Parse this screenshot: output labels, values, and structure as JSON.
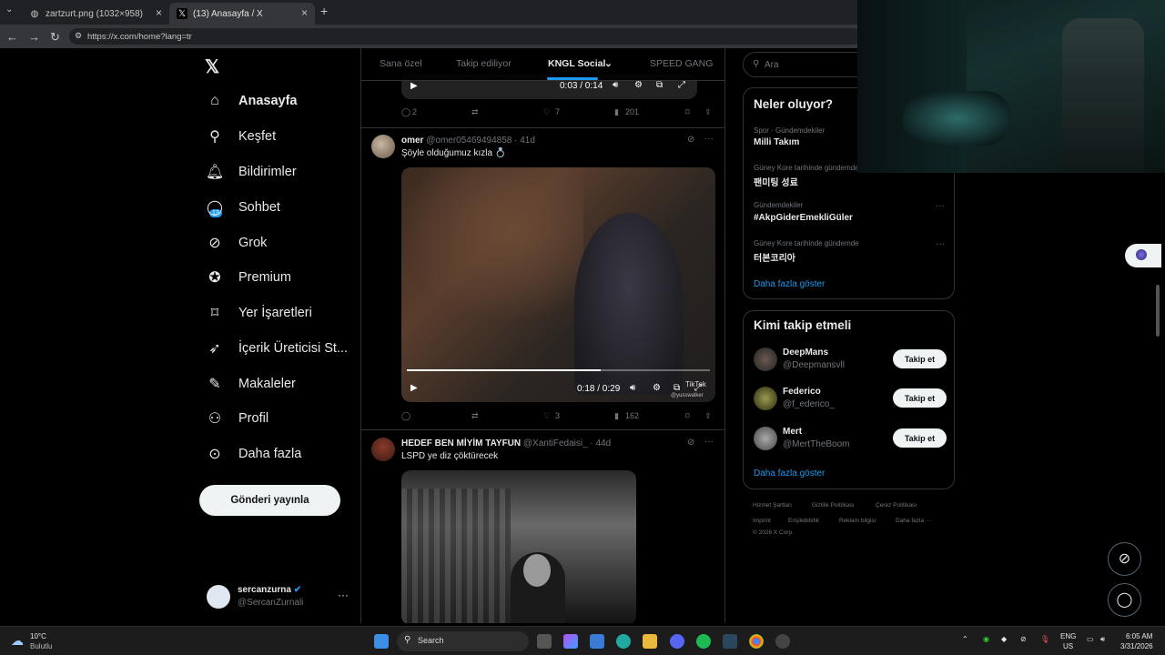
{
  "browser": {
    "tabs": [
      {
        "title": "zartzurt.png (1032×958)",
        "active": false
      },
      {
        "title": "(13) Anasayfa / X",
        "active": true
      }
    ],
    "url": "https://x.com/home?lang=tr"
  },
  "nav": {
    "items": [
      {
        "label": "Anasayfa",
        "icon": "home-icon"
      },
      {
        "label": "Keşfet",
        "icon": "search-icon"
      },
      {
        "label": "Bildirimler",
        "icon": "bell-icon"
      },
      {
        "label": "Sohbet",
        "icon": "chat-icon"
      },
      {
        "label": "Grok",
        "icon": "grok-icon"
      },
      {
        "label": "Premium",
        "icon": "premium-icon"
      },
      {
        "label": "Yer İşaretleri",
        "icon": "bookmark-icon"
      },
      {
        "label": "İçerik Üreticisi St...",
        "icon": "rocket-icon"
      },
      {
        "label": "Makaleler",
        "icon": "article-icon"
      },
      {
        "label": "Profil",
        "icon": "profile-icon"
      },
      {
        "label": "Daha fazla",
        "icon": "more-circle-icon"
      }
    ],
    "notif_badge": "13",
    "post_button": "Gönderi yayınla",
    "user": {
      "name": "sercanzurna",
      "handle": "@SercanZurnali",
      "more": "···"
    }
  },
  "timeline": {
    "tabs": [
      "Sana özel",
      "Takip ediliyor",
      "KNGL Social",
      "SPEED GANG"
    ],
    "top_video": {
      "time": "0:03 / 0:14"
    },
    "top_actions": {
      "replies": "2",
      "likes": "7",
      "views": "201"
    },
    "tweets": [
      {
        "name": "omer",
        "meta": "@omer05469494858 · 41d",
        "text": "Şöyle olduğumuz kızla 💍",
        "video_time": "0:18 / 0:29",
        "watermark": "TikTok",
        "watermark_user": "@yusswalker",
        "replies": "",
        "likes": "3",
        "views": "162"
      },
      {
        "name": "HEDEF BEN MİYİM TAYFUN",
        "meta": "@XantiFedaisi_ · 44d",
        "text": "LSPD ye diz çöktürecek"
      }
    ]
  },
  "right": {
    "search_placeholder": "Ara",
    "trends_title": "Neler oluyor?",
    "trends": [
      {
        "category": "Spor · Gündemdekiler",
        "name": "Milli Takım"
      },
      {
        "category": "Güney Kore tarihinde gündemde",
        "name": "팬미팅 성료"
      },
      {
        "category": "Gündemdekiler",
        "name": "#AkpGiderEmekliGüler"
      },
      {
        "category": "Güney Kore tarihinde gündemde",
        "name": "터본코리아"
      }
    ],
    "show_more": "Daha fazla göster",
    "follow_title": "Kimi takip etmeli",
    "follow": [
      {
        "name": "DeepMans",
        "handle": "@Deepmansvll",
        "button": "Takip et"
      },
      {
        "name": "Federico",
        "handle": "@f_ederico_",
        "button": "Takip et"
      },
      {
        "name": "Mert",
        "handle": "@MertTheBoom",
        "button": "Takip et"
      }
    ],
    "footer": [
      "Hizmet Şartları",
      "Gizlilik Politikası",
      "Çerez Politikası",
      "Imprint",
      "Erişilebilirlik",
      "Reklam bilgisi",
      "Daha fazla ···",
      "© 2026 X Corp."
    ]
  },
  "taskbar": {
    "weather_temp": "10°C",
    "weather_desc": "Bulutlu",
    "search": "Search",
    "lang1": "ENG",
    "lang2": "US",
    "time": "6:05 AM",
    "date": "3/31/2026"
  },
  "colors": {
    "accent": "#1d9bf0",
    "bg": "#000000",
    "border": "#2f3336",
    "muted": "#71767b"
  }
}
